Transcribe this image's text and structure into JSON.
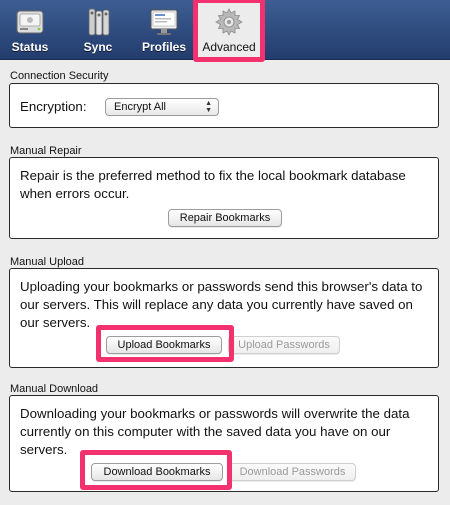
{
  "toolbar": {
    "tabs": [
      {
        "label": "Status",
        "icon": "status-drive-icon"
      },
      {
        "label": "Sync",
        "icon": "sync-keys-icon"
      },
      {
        "label": "Profiles",
        "icon": "profiles-monitor-icon"
      },
      {
        "label": "Advanced",
        "icon": "advanced-gear-icon",
        "selected": true
      }
    ]
  },
  "connection_security": {
    "title": "Connection Security",
    "encryption_label": "Encryption:",
    "encryption_value": "Encrypt All"
  },
  "manual_repair": {
    "title": "Manual Repair",
    "text": "Repair is the preferred method to fix the local bookmark database when errors occur.",
    "button": "Repair Bookmarks"
  },
  "manual_upload": {
    "title": "Manual Upload",
    "text": "Uploading your bookmarks or passwords send this browser's data to our servers. This will replace any data you currently have saved on our servers.",
    "button_bookmarks": "Upload Bookmarks",
    "button_passwords": "Upload Passwords"
  },
  "manual_download": {
    "title": "Manual Download",
    "text": "Downloading your bookmarks or passwords will overwrite the data currently on this computer with the saved data you have on our servers.",
    "button_bookmarks": "Download Bookmarks",
    "button_passwords": "Download Passwords"
  },
  "colors": {
    "toolbar": "#2c4a80",
    "highlight": "#f4316f"
  }
}
